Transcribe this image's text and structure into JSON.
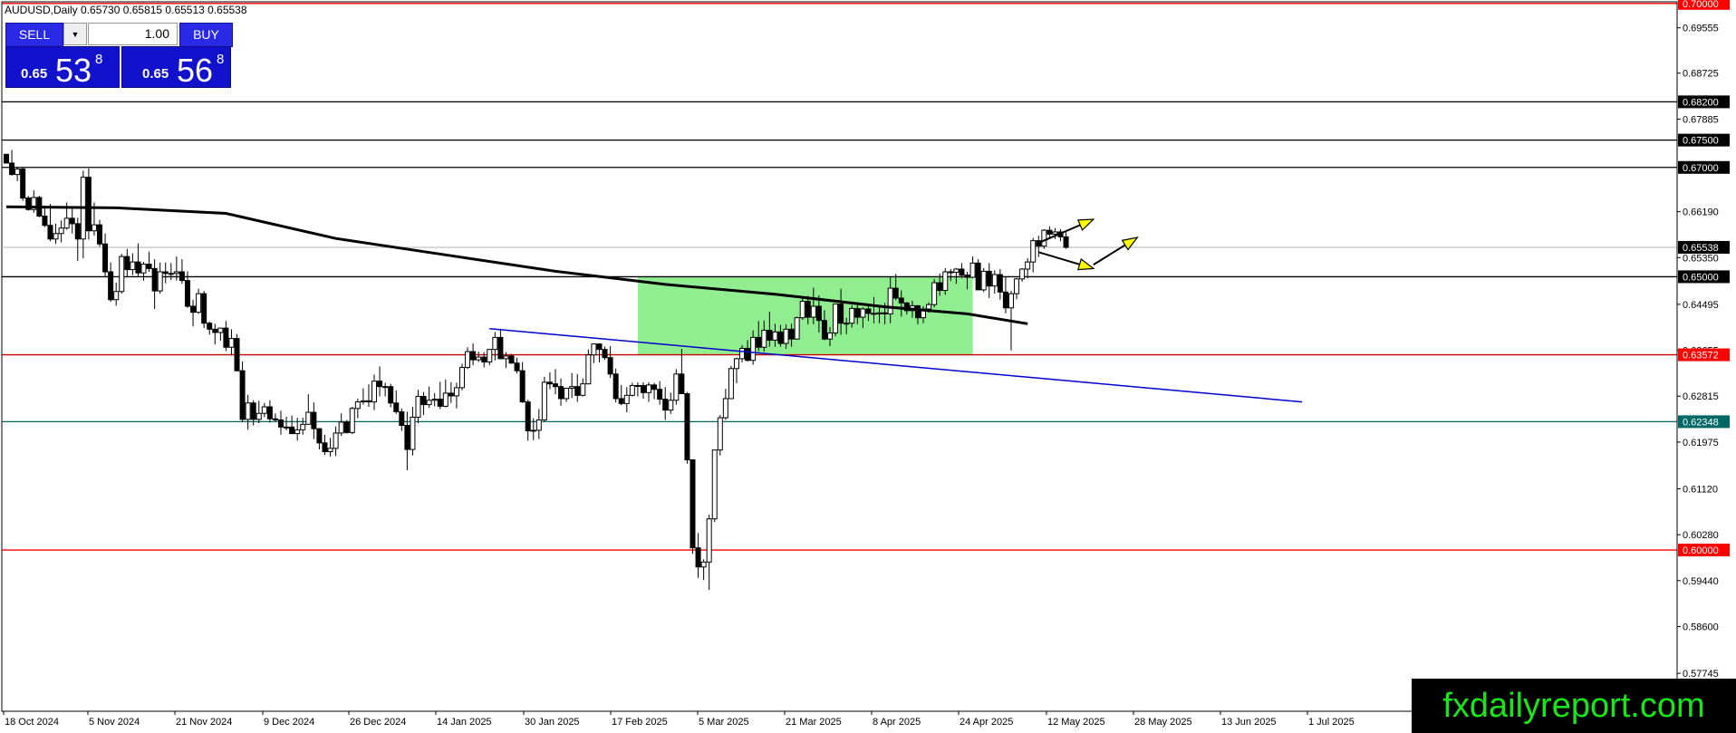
{
  "header": {
    "symbol_info": "AUDUSD,Daily  0.65730 0.65815 0.65513 0.65538"
  },
  "trade_panel": {
    "sell_label": "SELL",
    "buy_label": "BUY",
    "volume": "1.00",
    "sell_price": {
      "small": "0.65",
      "big": "53",
      "sup": "8"
    },
    "buy_price": {
      "small": "0.65",
      "big": "56",
      "sup": "8"
    }
  },
  "watermark": "fxdailyreport.com",
  "colors": {
    "candle_body": "#000000",
    "bull_body": "#ffffff",
    "zone_fill": "#90ee90",
    "trendline": "#0000cc",
    "support_red": "#ff0000",
    "support_teal": "#006666",
    "arrow_fill": "#ffff00",
    "current_price": "#808080"
  },
  "chart_data": {
    "type": "candlestick",
    "symbol": "AUDUSD",
    "timeframe": "Daily",
    "last": {
      "open": 0.6573,
      "high": 0.65815,
      "low": 0.65513,
      "close": 0.65538
    },
    "ylim": [
      0.5705,
      0.7003
    ],
    "price_ticks": [
      "0.69555",
      "0.68725",
      "0.67885",
      "0.66190",
      "0.65350",
      "0.64495",
      "0.63655",
      "0.62815",
      "0.61975",
      "0.61120",
      "0.60280",
      "0.59440",
      "0.58600",
      "0.57745"
    ],
    "x_ticks": [
      "18 Oct 2024",
      "5 Nov 2024",
      "21 Nov 2024",
      "9 Dec 2024",
      "26 Dec 2024",
      "14 Jan 2025",
      "30 Jan 2025",
      "17 Feb 2025",
      "5 Mar 2025",
      "21 Mar 2025",
      "8 Apr 2025",
      "24 Apr 2025",
      "12 May 2025",
      "28 May 2025",
      "13 Jun 2025",
      "1 Jul 2025"
    ],
    "levels": [
      {
        "price": 0.7,
        "label": "0.70000",
        "color": "#ff0000",
        "tag_bg": "#ff0000",
        "tag_fg": "#ffffff"
      },
      {
        "price": 0.682,
        "label": "0.68200",
        "color": "#000000",
        "tag_bg": "#000000",
        "tag_fg": "#ffffff"
      },
      {
        "price": 0.675,
        "label": "0.67500",
        "color": "#000000",
        "tag_bg": "#000000",
        "tag_fg": "#ffffff"
      },
      {
        "price": 0.67,
        "label": "0.67000",
        "color": "#000000",
        "tag_bg": "#000000",
        "tag_fg": "#ffffff"
      },
      {
        "price": 0.65538,
        "label": "0.65538",
        "color": "#c0c0c0",
        "tag_bg": "#000000",
        "tag_fg": "#ffffff"
      },
      {
        "price": 0.65,
        "label": "0.65000",
        "color": "#000000",
        "tag_bg": "#000000",
        "tag_fg": "#ffffff"
      },
      {
        "price": 0.63572,
        "label": "0.63572",
        "color": "#cc0000",
        "tag_bg": "#ff0000",
        "tag_fg": "#ffffff"
      },
      {
        "price": 0.62348,
        "label": "0.62348",
        "color": "#006666",
        "tag_bg": "#006666",
        "tag_fg": "#ffffff"
      },
      {
        "price": 0.6,
        "label": "0.60000",
        "color": "#ff0000",
        "tag_bg": "#ff0000",
        "tag_fg": "#ffffff"
      }
    ],
    "zone": {
      "from_index": 115,
      "to_index": 176,
      "price_high": 0.65,
      "price_low": 0.63572
    },
    "trendline": {
      "from_index": 88,
      "from_price": 0.6405,
      "to_index": 236,
      "to_price": 0.6271
    },
    "moving_average": [
      {
        "i": 0,
        "v": 0.6628
      },
      {
        "i": 20,
        "v": 0.6626
      },
      {
        "i": 40,
        "v": 0.6616
      },
      {
        "i": 60,
        "v": 0.657
      },
      {
        "i": 80,
        "v": 0.654
      },
      {
        "i": 100,
        "v": 0.651
      },
      {
        "i": 120,
        "v": 0.6486
      },
      {
        "i": 140,
        "v": 0.6468
      },
      {
        "i": 160,
        "v": 0.6445
      },
      {
        "i": 175,
        "v": 0.6432
      },
      {
        "i": 186,
        "v": 0.6414
      }
    ],
    "arrows": [
      {
        "from_index": 188,
        "from_price": 0.6562,
        "to_index": 198,
        "to_price": 0.6605
      },
      {
        "from_index": 188,
        "from_price": 0.6545,
        "to_index": 198,
        "to_price": 0.6515
      },
      {
        "from_index": 198,
        "from_price": 0.6522,
        "to_index": 206,
        "to_price": 0.6572
      }
    ],
    "candles": [
      [
        0.6724,
        0.6724,
        0.6708,
        0.6708
      ],
      [
        0.6708,
        0.6732,
        0.6685,
        0.6687
      ],
      [
        0.6687,
        0.6701,
        0.6675,
        0.6697
      ],
      [
        0.6697,
        0.6701,
        0.6639,
        0.6644
      ],
      [
        0.6644,
        0.6648,
        0.6621,
        0.6623
      ],
      [
        0.6623,
        0.6658,
        0.6617,
        0.6645
      ],
      [
        0.6645,
        0.6648,
        0.6609,
        0.6611
      ],
      [
        0.6611,
        0.663,
        0.6591,
        0.6594
      ],
      [
        0.6594,
        0.6633,
        0.6565,
        0.6569
      ],
      [
        0.6569,
        0.6597,
        0.656,
        0.6579
      ],
      [
        0.6579,
        0.6603,
        0.6563,
        0.6589
      ],
      [
        0.6589,
        0.6636,
        0.6586,
        0.6607
      ],
      [
        0.6607,
        0.6628,
        0.6579,
        0.6597
      ],
      [
        0.6597,
        0.6608,
        0.6529,
        0.6569
      ],
      [
        0.6569,
        0.6694,
        0.6534,
        0.6682
      ],
      [
        0.6682,
        0.6698,
        0.6568,
        0.6584
      ],
      [
        0.6584,
        0.6636,
        0.6575,
        0.6595
      ],
      [
        0.6595,
        0.6604,
        0.6555,
        0.656
      ],
      [
        0.656,
        0.6579,
        0.6501,
        0.6509
      ],
      [
        0.6509,
        0.6526,
        0.6454,
        0.6458
      ],
      [
        0.6458,
        0.6489,
        0.6447,
        0.6473
      ],
      [
        0.6473,
        0.6542,
        0.6469,
        0.6537
      ],
      [
        0.6537,
        0.6551,
        0.6499,
        0.6513
      ],
      [
        0.6513,
        0.6543,
        0.6503,
        0.6527
      ],
      [
        0.6527,
        0.6561,
        0.6501,
        0.6507
      ],
      [
        0.6507,
        0.6527,
        0.6493,
        0.6523
      ],
      [
        0.6523,
        0.6546,
        0.6509,
        0.6515
      ],
      [
        0.6515,
        0.6532,
        0.6441,
        0.6474
      ],
      [
        0.6474,
        0.6526,
        0.6469,
        0.6509
      ],
      [
        0.6509,
        0.6526,
        0.6488,
        0.6506
      ],
      [
        0.6506,
        0.6525,
        0.6494,
        0.6506
      ],
      [
        0.6506,
        0.6537,
        0.6493,
        0.6509
      ],
      [
        0.6509,
        0.6532,
        0.6487,
        0.6493
      ],
      [
        0.6493,
        0.651,
        0.6443,
        0.6446
      ],
      [
        0.6446,
        0.6458,
        0.6409,
        0.6435
      ],
      [
        0.6435,
        0.6478,
        0.6432,
        0.6469
      ],
      [
        0.6469,
        0.6474,
        0.6406,
        0.6415
      ],
      [
        0.6415,
        0.6418,
        0.6394,
        0.6404
      ],
      [
        0.6404,
        0.6414,
        0.6376,
        0.6398
      ],
      [
        0.6398,
        0.6407,
        0.6383,
        0.6406
      ],
      [
        0.6406,
        0.6419,
        0.6364,
        0.6371
      ],
      [
        0.6371,
        0.6404,
        0.6356,
        0.6387
      ],
      [
        0.6387,
        0.6395,
        0.6327,
        0.6328
      ],
      [
        0.6328,
        0.6345,
        0.6234,
        0.6239
      ],
      [
        0.6239,
        0.6284,
        0.622,
        0.6269
      ],
      [
        0.6269,
        0.6274,
        0.6228,
        0.6239
      ],
      [
        0.6239,
        0.6273,
        0.6232,
        0.625
      ],
      [
        0.625,
        0.6269,
        0.6243,
        0.6262
      ],
      [
        0.6262,
        0.6274,
        0.6233,
        0.624
      ],
      [
        0.624,
        0.625,
        0.6235,
        0.6238
      ],
      [
        0.6238,
        0.6255,
        0.6211,
        0.6225
      ],
      [
        0.6225,
        0.6244,
        0.6219,
        0.6225
      ],
      [
        0.6225,
        0.6246,
        0.6212,
        0.6213
      ],
      [
        0.6213,
        0.6242,
        0.62,
        0.622
      ],
      [
        0.622,
        0.6242,
        0.6211,
        0.623
      ],
      [
        0.623,
        0.6285,
        0.6229,
        0.6252
      ],
      [
        0.6252,
        0.627,
        0.6203,
        0.6222
      ],
      [
        0.6222,
        0.6223,
        0.6184,
        0.6196
      ],
      [
        0.6196,
        0.6211,
        0.6174,
        0.618
      ],
      [
        0.618,
        0.6205,
        0.6171,
        0.6186
      ],
      [
        0.6186,
        0.6226,
        0.6172,
        0.6214
      ],
      [
        0.6214,
        0.625,
        0.6209,
        0.6234
      ],
      [
        0.6234,
        0.6238,
        0.6213,
        0.6215
      ],
      [
        0.6215,
        0.6262,
        0.6212,
        0.6259
      ],
      [
        0.6259,
        0.6277,
        0.6241,
        0.6271
      ],
      [
        0.6271,
        0.6296,
        0.6266,
        0.6273
      ],
      [
        0.6273,
        0.6303,
        0.6262,
        0.6271
      ],
      [
        0.6271,
        0.6321,
        0.6256,
        0.6309
      ],
      [
        0.6309,
        0.6336,
        0.6281,
        0.6299
      ],
      [
        0.6299,
        0.6306,
        0.6281,
        0.6299
      ],
      [
        0.6299,
        0.6304,
        0.6261,
        0.6269
      ],
      [
        0.6269,
        0.6292,
        0.6249,
        0.6253
      ],
      [
        0.6253,
        0.6259,
        0.6218,
        0.6228
      ],
      [
        0.6228,
        0.6253,
        0.6146,
        0.6184
      ],
      [
        0.6184,
        0.6262,
        0.6173,
        0.6243
      ],
      [
        0.6243,
        0.6293,
        0.6232,
        0.6281
      ],
      [
        0.6281,
        0.6289,
        0.6247,
        0.6266
      ],
      [
        0.6266,
        0.6299,
        0.626,
        0.6274
      ],
      [
        0.6274,
        0.6287,
        0.6263,
        0.6276
      ],
      [
        0.6276,
        0.6308,
        0.6258,
        0.6263
      ],
      [
        0.6263,
        0.6312,
        0.6261,
        0.6287
      ],
      [
        0.6287,
        0.6307,
        0.6269,
        0.6282
      ],
      [
        0.6282,
        0.6306,
        0.6259,
        0.6297
      ],
      [
        0.6297,
        0.6341,
        0.6292,
        0.6334
      ],
      [
        0.6334,
        0.6371,
        0.6331,
        0.6363
      ],
      [
        0.6363,
        0.6378,
        0.6338,
        0.6348
      ],
      [
        0.6348,
        0.6363,
        0.6344,
        0.6353
      ],
      [
        0.6353,
        0.6362,
        0.6334,
        0.6344
      ],
      [
        0.6344,
        0.6368,
        0.6338,
        0.6367
      ],
      [
        0.6367,
        0.6399,
        0.6347,
        0.6389
      ],
      [
        0.6389,
        0.6405,
        0.6349,
        0.635
      ],
      [
        0.635,
        0.6362,
        0.6333,
        0.6355
      ],
      [
        0.6355,
        0.6359,
        0.6341,
        0.6342
      ],
      [
        0.6342,
        0.6352,
        0.6323,
        0.6328
      ],
      [
        0.6328,
        0.6344,
        0.6269,
        0.6271
      ],
      [
        0.6271,
        0.6275,
        0.62,
        0.6218
      ],
      [
        0.6218,
        0.6241,
        0.6201,
        0.6219
      ],
      [
        0.6219,
        0.6258,
        0.6203,
        0.6238
      ],
      [
        0.6238,
        0.6317,
        0.6235,
        0.6307
      ],
      [
        0.6307,
        0.6325,
        0.6294,
        0.6304
      ],
      [
        0.6304,
        0.6331,
        0.6285,
        0.6299
      ],
      [
        0.6299,
        0.6314,
        0.6264,
        0.6277
      ],
      [
        0.6277,
        0.6297,
        0.6271,
        0.6296
      ],
      [
        0.6296,
        0.6324,
        0.6278,
        0.6299
      ],
      [
        0.6299,
        0.6322,
        0.6271,
        0.6283
      ],
      [
        0.6283,
        0.6314,
        0.6281,
        0.6304
      ],
      [
        0.6304,
        0.6367,
        0.6303,
        0.6357
      ],
      [
        0.6357,
        0.6378,
        0.6342,
        0.6377
      ],
      [
        0.6377,
        0.6378,
        0.6343,
        0.6367
      ],
      [
        0.6367,
        0.6372,
        0.6348,
        0.6352
      ],
      [
        0.6352,
        0.6373,
        0.6315,
        0.6322
      ],
      [
        0.6322,
        0.6332,
        0.627,
        0.6277
      ],
      [
        0.6277,
        0.6302,
        0.6265,
        0.6268
      ],
      [
        0.6268,
        0.6298,
        0.6252,
        0.6283
      ],
      [
        0.6283,
        0.6306,
        0.6281,
        0.6301
      ],
      [
        0.6301,
        0.6307,
        0.6281,
        0.6301
      ],
      [
        0.6301,
        0.6307,
        0.6277,
        0.6288
      ],
      [
        0.6288,
        0.6307,
        0.6271,
        0.6302
      ],
      [
        0.6302,
        0.6306,
        0.6276,
        0.6294
      ],
      [
        0.6294,
        0.6309,
        0.6266,
        0.6276
      ],
      [
        0.6276,
        0.6298,
        0.6238,
        0.6256
      ],
      [
        0.6256,
        0.6288,
        0.6249,
        0.6274
      ],
      [
        0.6274,
        0.6331,
        0.6266,
        0.6322
      ],
      [
        0.6322,
        0.6368,
        0.6302,
        0.6286
      ],
      [
        0.6286,
        0.6289,
        0.6158,
        0.6165
      ],
      [
        0.6165,
        0.6166,
        0.5993,
        0.6004
      ],
      [
        0.6004,
        0.6031,
        0.5949,
        0.5969
      ],
      [
        0.5969,
        0.5983,
        0.5945,
        0.5978
      ],
      [
        0.5978,
        0.6065,
        0.5927,
        0.6057
      ],
      [
        0.6057,
        0.6182,
        0.6051,
        0.6183
      ],
      [
        0.6183,
        0.6247,
        0.6173,
        0.6242
      ],
      [
        0.6242,
        0.6295,
        0.6238,
        0.6277
      ],
      [
        0.6277,
        0.6337,
        0.6276,
        0.6332
      ],
      [
        0.6332,
        0.6352,
        0.6305,
        0.635
      ],
      [
        0.635,
        0.6375,
        0.6343,
        0.6369
      ],
      [
        0.6369,
        0.6384,
        0.6345,
        0.6347
      ],
      [
        0.6347,
        0.6402,
        0.6339,
        0.6389
      ],
      [
        0.6389,
        0.6419,
        0.6364,
        0.6371
      ],
      [
        0.6371,
        0.642,
        0.6363,
        0.6402
      ],
      [
        0.6402,
        0.6436,
        0.6372,
        0.6384
      ],
      [
        0.6384,
        0.6414,
        0.6372,
        0.6399
      ],
      [
        0.6399,
        0.6412,
        0.6372,
        0.6378
      ],
      [
        0.6378,
        0.6413,
        0.6368,
        0.6404
      ],
      [
        0.6404,
        0.6414,
        0.6372,
        0.6386
      ],
      [
        0.6386,
        0.6427,
        0.6385,
        0.6425
      ],
      [
        0.6425,
        0.646,
        0.6421,
        0.6455
      ],
      [
        0.6455,
        0.6465,
        0.6413,
        0.6426
      ],
      [
        0.6426,
        0.648,
        0.6413,
        0.6446
      ],
      [
        0.6446,
        0.6466,
        0.6398,
        0.642
      ],
      [
        0.642,
        0.6439,
        0.6384,
        0.6386
      ],
      [
        0.6386,
        0.6408,
        0.6373,
        0.6397
      ],
      [
        0.6397,
        0.6451,
        0.6391,
        0.645
      ],
      [
        0.645,
        0.6478,
        0.6394,
        0.6415
      ],
      [
        0.6415,
        0.6425,
        0.6395,
        0.6415
      ],
      [
        0.6415,
        0.6448,
        0.6407,
        0.6442
      ],
      [
        0.6442,
        0.6451,
        0.6413,
        0.6426
      ],
      [
        0.6426,
        0.6444,
        0.6406,
        0.6441
      ],
      [
        0.6441,
        0.6449,
        0.6419,
        0.6433
      ],
      [
        0.6433,
        0.6463,
        0.6415,
        0.6432
      ],
      [
        0.6432,
        0.6448,
        0.6415,
        0.6434
      ],
      [
        0.6434,
        0.6452,
        0.6413,
        0.6432
      ],
      [
        0.6432,
        0.6499,
        0.6415,
        0.6479
      ],
      [
        0.6479,
        0.6505,
        0.6457,
        0.6461
      ],
      [
        0.6461,
        0.6475,
        0.6427,
        0.6452
      ],
      [
        0.6452,
        0.6454,
        0.6431,
        0.6438
      ],
      [
        0.6438,
        0.6456,
        0.6425,
        0.6447
      ],
      [
        0.6447,
        0.6448,
        0.6413,
        0.6425
      ],
      [
        0.6425,
        0.6446,
        0.6415,
        0.6441
      ],
      [
        0.6441,
        0.6453,
        0.6434,
        0.6449
      ],
      [
        0.6449,
        0.6496,
        0.6444,
        0.6489
      ],
      [
        0.6489,
        0.6506,
        0.6465,
        0.6475
      ],
      [
        0.6475,
        0.6516,
        0.6467,
        0.6509
      ],
      [
        0.6509,
        0.6514,
        0.6492,
        0.6508
      ],
      [
        0.6508,
        0.6516,
        0.6487,
        0.6514
      ],
      [
        0.6514,
        0.6525,
        0.6497,
        0.6503
      ],
      [
        0.6503,
        0.6509,
        0.6477,
        0.6499
      ],
      [
        0.6499,
        0.6537,
        0.6497,
        0.6525
      ],
      [
        0.6525,
        0.6532,
        0.6476,
        0.6476
      ],
      [
        0.6476,
        0.6516,
        0.6472,
        0.651
      ],
      [
        0.651,
        0.6525,
        0.6461,
        0.6483
      ],
      [
        0.6483,
        0.6512,
        0.6469,
        0.6504
      ],
      [
        0.6504,
        0.6514,
        0.6458,
        0.6472
      ],
      [
        0.6472,
        0.6499,
        0.6433,
        0.6443
      ],
      [
        0.6443,
        0.6474,
        0.6365,
        0.6469
      ],
      [
        0.6469,
        0.6498,
        0.6459,
        0.6496
      ],
      [
        0.6496,
        0.6516,
        0.6491,
        0.6514
      ],
      [
        0.6514,
        0.6534,
        0.6497,
        0.6527
      ],
      [
        0.6527,
        0.6571,
        0.6508,
        0.6566
      ],
      [
        0.6566,
        0.6575,
        0.6536,
        0.6556
      ],
      [
        0.6556,
        0.6587,
        0.6551,
        0.6585
      ],
      [
        0.6585,
        0.6592,
        0.6572,
        0.6578
      ],
      [
        0.6578,
        0.6589,
        0.6569,
        0.6582
      ],
      [
        0.6582,
        0.6587,
        0.6565,
        0.6573
      ],
      [
        0.6573,
        0.65815,
        0.65513,
        0.65538
      ]
    ]
  }
}
